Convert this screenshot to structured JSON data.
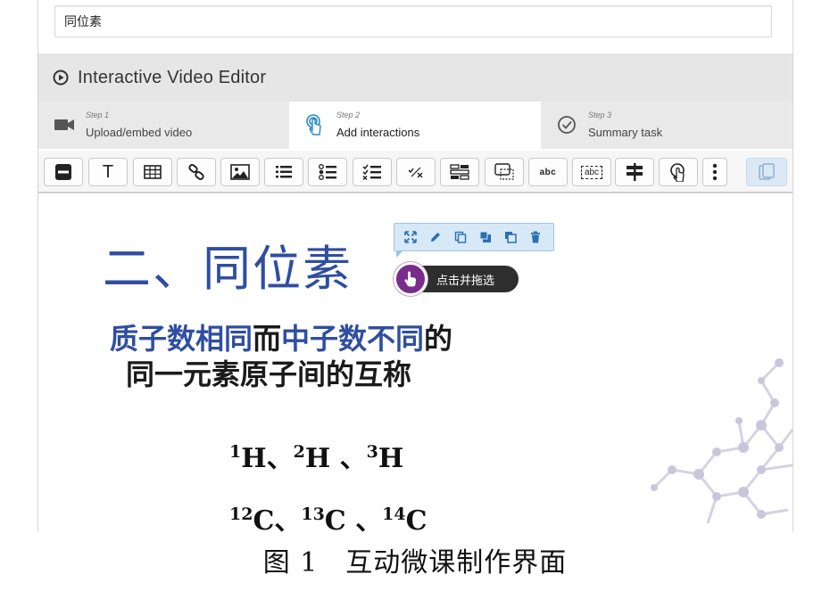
{
  "title_field": {
    "value": "同位素"
  },
  "header": {
    "title": "Interactive Video Editor"
  },
  "steps": [
    {
      "number": "Step 1",
      "label": "Upload/embed video",
      "icon": "video-camera-icon"
    },
    {
      "number": "Step 2",
      "label": "Add interactions",
      "icon": "touch-icon"
    },
    {
      "number": "Step 3",
      "label": "Summary task",
      "icon": "check-circle-icon"
    }
  ],
  "toolbar": {
    "text_button": "T",
    "fill_in_button": "abc",
    "sorting_button": "abc"
  },
  "slide": {
    "title": "二、同位素",
    "definition_line1": [
      {
        "text": "质子数相同",
        "color": "blue"
      },
      {
        "text": "而",
        "color": "black"
      },
      {
        "text": "中子数不同",
        "color": "blue"
      },
      {
        "text": "的",
        "color": "black"
      }
    ],
    "definition_line2": "同一元素原子间的互称",
    "isotopes_h": [
      {
        "mass": "1",
        "symbol": "H"
      },
      {
        "mass": "2",
        "symbol": "H"
      },
      {
        "mass": "3",
        "symbol": "H"
      }
    ],
    "isotopes_c": [
      {
        "mass": "12",
        "symbol": "C"
      },
      {
        "mass": "13",
        "symbol": "C"
      },
      {
        "mass": "14",
        "symbol": "C"
      }
    ],
    "separator": "、"
  },
  "drag_tip": {
    "text": "点击并拖选"
  },
  "caption": "图 1　互动微课制作界面",
  "colors": {
    "accent_blue": "#2f4ea1",
    "tip_purple": "#7a2c8c",
    "header_gray": "#e6e6e6"
  }
}
